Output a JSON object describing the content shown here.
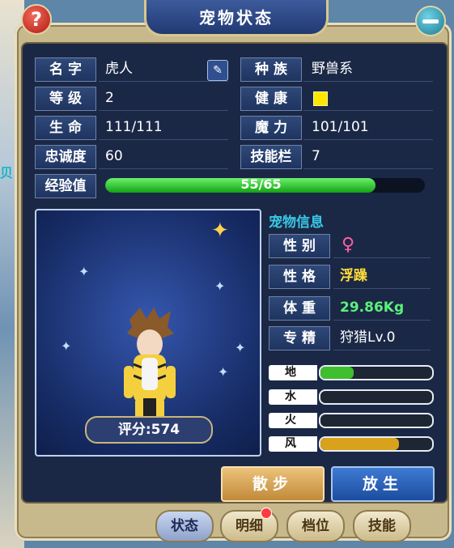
{
  "window": {
    "title": "宠物状态",
    "help_icon_text": "?"
  },
  "background": {
    "left_text": "贝"
  },
  "info": {
    "name_label": "名 字",
    "name": "虎人",
    "race_label": "种 族",
    "race": "野兽系",
    "level_label": "等 级",
    "level": "2",
    "health_label": "健 康",
    "health_color": "#ffe600",
    "hp_label": "生 命",
    "hp": "111/111",
    "mp_label": "魔 力",
    "mp": "101/101",
    "loyalty_label": "忠诚度",
    "loyalty": "60",
    "skill_slot_label": "技能栏",
    "skill_slot": "7",
    "exp_label": "经验值",
    "exp": "55/65",
    "exp_current": 55,
    "exp_max": 65
  },
  "portrait": {
    "score": "评分:574"
  },
  "pet_info": {
    "section_title": "宠物信息",
    "gender_label": "性 别",
    "gender": "♀",
    "personality_label": "性 格",
    "personality": "浮躁",
    "weight_label": "体 重",
    "weight": "29.86Kg",
    "specialty_label": "专 精",
    "specialty": "狩猎Lv.0"
  },
  "elements": [
    {
      "label": "地",
      "fraction": 0.3,
      "color": "#3fbf2e"
    },
    {
      "label": "水",
      "fraction": 0.0,
      "color": "#3aa3e6"
    },
    {
      "label": "火",
      "fraction": 0.0,
      "color": "#e64a3a"
    },
    {
      "label": "风",
      "fraction": 0.7,
      "color": "#d9a21c"
    }
  ],
  "buttons": {
    "walk": "散步",
    "release": "放生"
  },
  "tabs": [
    "状态",
    "明细",
    "档位",
    "技能"
  ]
}
